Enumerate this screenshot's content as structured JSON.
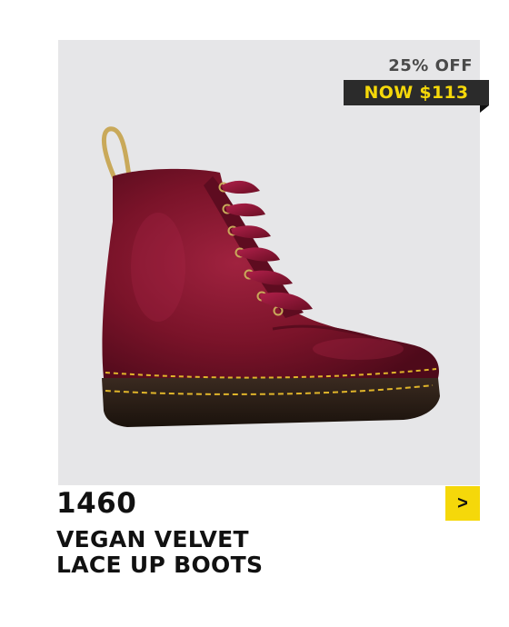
{
  "product": {
    "discount_text": "25% OFF",
    "price_text": "NOW $113",
    "model": "1460",
    "name_line1": "VEGAN VELVET",
    "name_line2": "LACE UP BOOTS",
    "next_label": ">"
  },
  "image": {
    "subject": "boot-image",
    "alt": "burgundy velvet lace-up boot"
  },
  "colors": {
    "panel_bg": "#e6e6e8",
    "price_tag_bg": "#2b2b2b",
    "accent_yellow": "#f5d80a",
    "boot_velvet": "#7a1329",
    "sole": "#2a1e16",
    "stitching": "#e0b52a"
  }
}
